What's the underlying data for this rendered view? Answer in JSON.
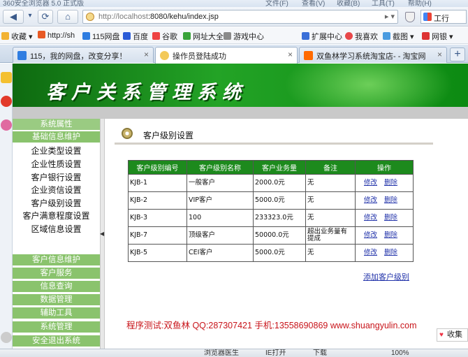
{
  "browser": {
    "window_title": "360安全浏览器 5.0 正式版",
    "title_menu": [
      "文件(F)",
      "查看(V)",
      "收藏(B)",
      "工具(T)",
      "帮助(H)"
    ],
    "url_host": "http://localhost",
    "url_rest": ":8080/kehu/index.jsp",
    "search_label": "工行",
    "favorites": [
      "收藏",
      "http://sh",
      "115网盘",
      "百度",
      "谷歌",
      "网址大全",
      "游戏中心",
      "扩展中心",
      "我喜欢",
      "截图",
      "网银"
    ],
    "tabs": [
      {
        "label": "115，我的网盘，改变分享！",
        "active": false
      },
      {
        "label": "操作员登陆成功",
        "active": true
      },
      {
        "label": "双鱼林学习系统淘宝店- - 淘宝网",
        "active": false
      }
    ],
    "status_items": [
      "浏览器医生",
      "IE打开",
      "下载",
      "100%"
    ],
    "collect_label": "收集"
  },
  "header": {
    "title": "客户关系管理系统"
  },
  "sidebar": {
    "group1": "系统属性",
    "group2": "基础信息维护",
    "items": [
      "企业类型设置",
      "企业性质设置",
      "客户银行设置",
      "企业资信设置",
      "客户级别设置",
      "客户满意程度设置",
      "区域信息设置"
    ],
    "groups_bottom": [
      "客户信息维护",
      "客户服务",
      "信息查询",
      "数据管理",
      "辅助工具",
      "系统管理",
      "安全退出系统"
    ]
  },
  "main": {
    "section_title": "客户级别设置",
    "columns": [
      "客户级别编号",
      "客户级别名称",
      "客户业务量",
      "备注",
      "操作"
    ],
    "rows": [
      {
        "id": "KJB-1",
        "name": "一般客户",
        "volume": "2000.0元",
        "note": "无",
        "edit": "修改",
        "del": "删除"
      },
      {
        "id": "KJB-2",
        "name": "VIP客户",
        "volume": "5000.0元",
        "note": "无",
        "edit": "修改",
        "del": "删除"
      },
      {
        "id": "KJB-3",
        "name": "100",
        "volume": "233323.0元",
        "note": "无",
        "edit": "修改",
        "del": "删除"
      },
      {
        "id": "KJB-7",
        "name": "顶级客户",
        "volume": "50000.0元",
        "note": "超出业务量有提成",
        "edit": "修改",
        "del": "删除"
      },
      {
        "id": "KJB-5",
        "name": "CEI客户",
        "volume": "5000.0元",
        "note": "无",
        "edit": "修改",
        "del": "删除"
      }
    ],
    "add_link": "添加客户级别",
    "credit": "程序测试:双鱼林 QQ:287307421 手机:13558690869 www.shuangyulin.com"
  }
}
